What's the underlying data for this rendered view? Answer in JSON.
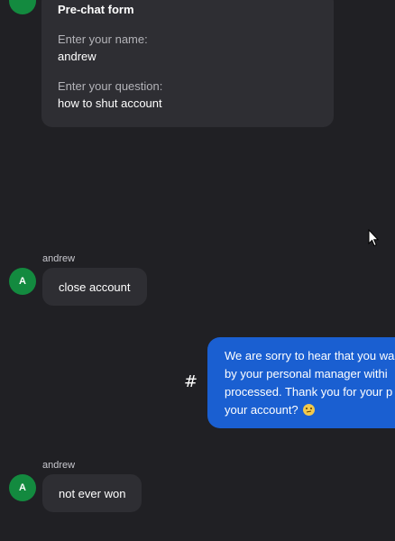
{
  "prechat": {
    "avatar_initial": "",
    "title": "Pre-chat form",
    "name_label": "Enter your name:",
    "name_value": "andrew",
    "question_label": "Enter your question:",
    "question_value": "how to shut account"
  },
  "messages": [
    {
      "sender": "andrew",
      "avatar_initial": "A",
      "text": "close account"
    },
    {
      "sender": "andrew",
      "avatar_initial": "A",
      "text": "not ever won"
    }
  ],
  "agent_message": {
    "lines": [
      "We are sorry to hear that you wa",
      "by your personal manager withi",
      "processed. Thank you for your p",
      "your account?"
    ],
    "emoji": "confused-face-icon"
  },
  "hash_symbol": "#",
  "colors": {
    "background": "#202024",
    "card": "#2e2e33",
    "avatar": "#138a3f",
    "agent_bubble": "#1a5fd1",
    "muted_text": "#b3b3b8"
  }
}
